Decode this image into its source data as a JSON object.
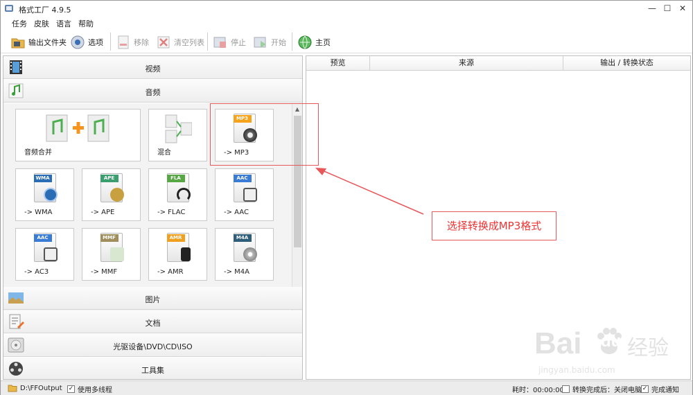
{
  "window": {
    "title": "格式工厂 4.9.5",
    "minimize": "—",
    "maximize": "☐",
    "close": "✕"
  },
  "menu": [
    "任务",
    "皮肤",
    "语言",
    "帮助"
  ],
  "toolbar": {
    "output_folder": "输出文件夹",
    "options": "选项",
    "remove": "移除",
    "clear_list": "清空列表",
    "stop": "停止",
    "start": "开始",
    "home": "主页"
  },
  "categories": {
    "video": "视频",
    "audio": "音频",
    "image": "图片",
    "document": "文档",
    "optical": "光驱设备\\DVD\\CD\\ISO",
    "tools": "工具集"
  },
  "tiles": [
    {
      "label": "音频合并",
      "badge": ""
    },
    {
      "label": "混合",
      "badge": ""
    },
    {
      "label": "-> MP3",
      "badge": "MP3"
    },
    {
      "label": "-> WMA",
      "badge": "WMA"
    },
    {
      "label": "-> APE",
      "badge": "APE"
    },
    {
      "label": "-> FLAC",
      "badge": "FLA"
    },
    {
      "label": "-> AAC",
      "badge": "AAC"
    },
    {
      "label": "-> AC3",
      "badge": "AAC"
    },
    {
      "label": "-> MMF",
      "badge": "MMF"
    },
    {
      "label": "-> AMR",
      "badge": "AMR"
    },
    {
      "label": "-> M4A",
      "badge": "M4A"
    }
  ],
  "table": {
    "columns": [
      "预览",
      "来源",
      "输出 / 转换状态"
    ]
  },
  "annotation": {
    "text": "选择转换成MP3格式"
  },
  "statusbar": {
    "output_path": "D:\\FFOutput",
    "multithread": "使用多线程",
    "elapsed": "耗时：00:00:00",
    "after_convert": "转换完成后：关闭电脑",
    "notify": "完成通知"
  },
  "watermark": {
    "brand": "Bai",
    "brand2": "du",
    "cn": "经验",
    "url": "jingyan.baidu.com"
  },
  "colors": {
    "accent_red": "#e8575a",
    "wma": "#2b6db5",
    "ape": "#3b9e6e",
    "fla": "#57a845",
    "aac": "#3a7bd5",
    "mmf": "#a08e5c",
    "amr": "#f0a020",
    "m4a": "#2f5e7a",
    "mp3": "#f7a21b"
  }
}
